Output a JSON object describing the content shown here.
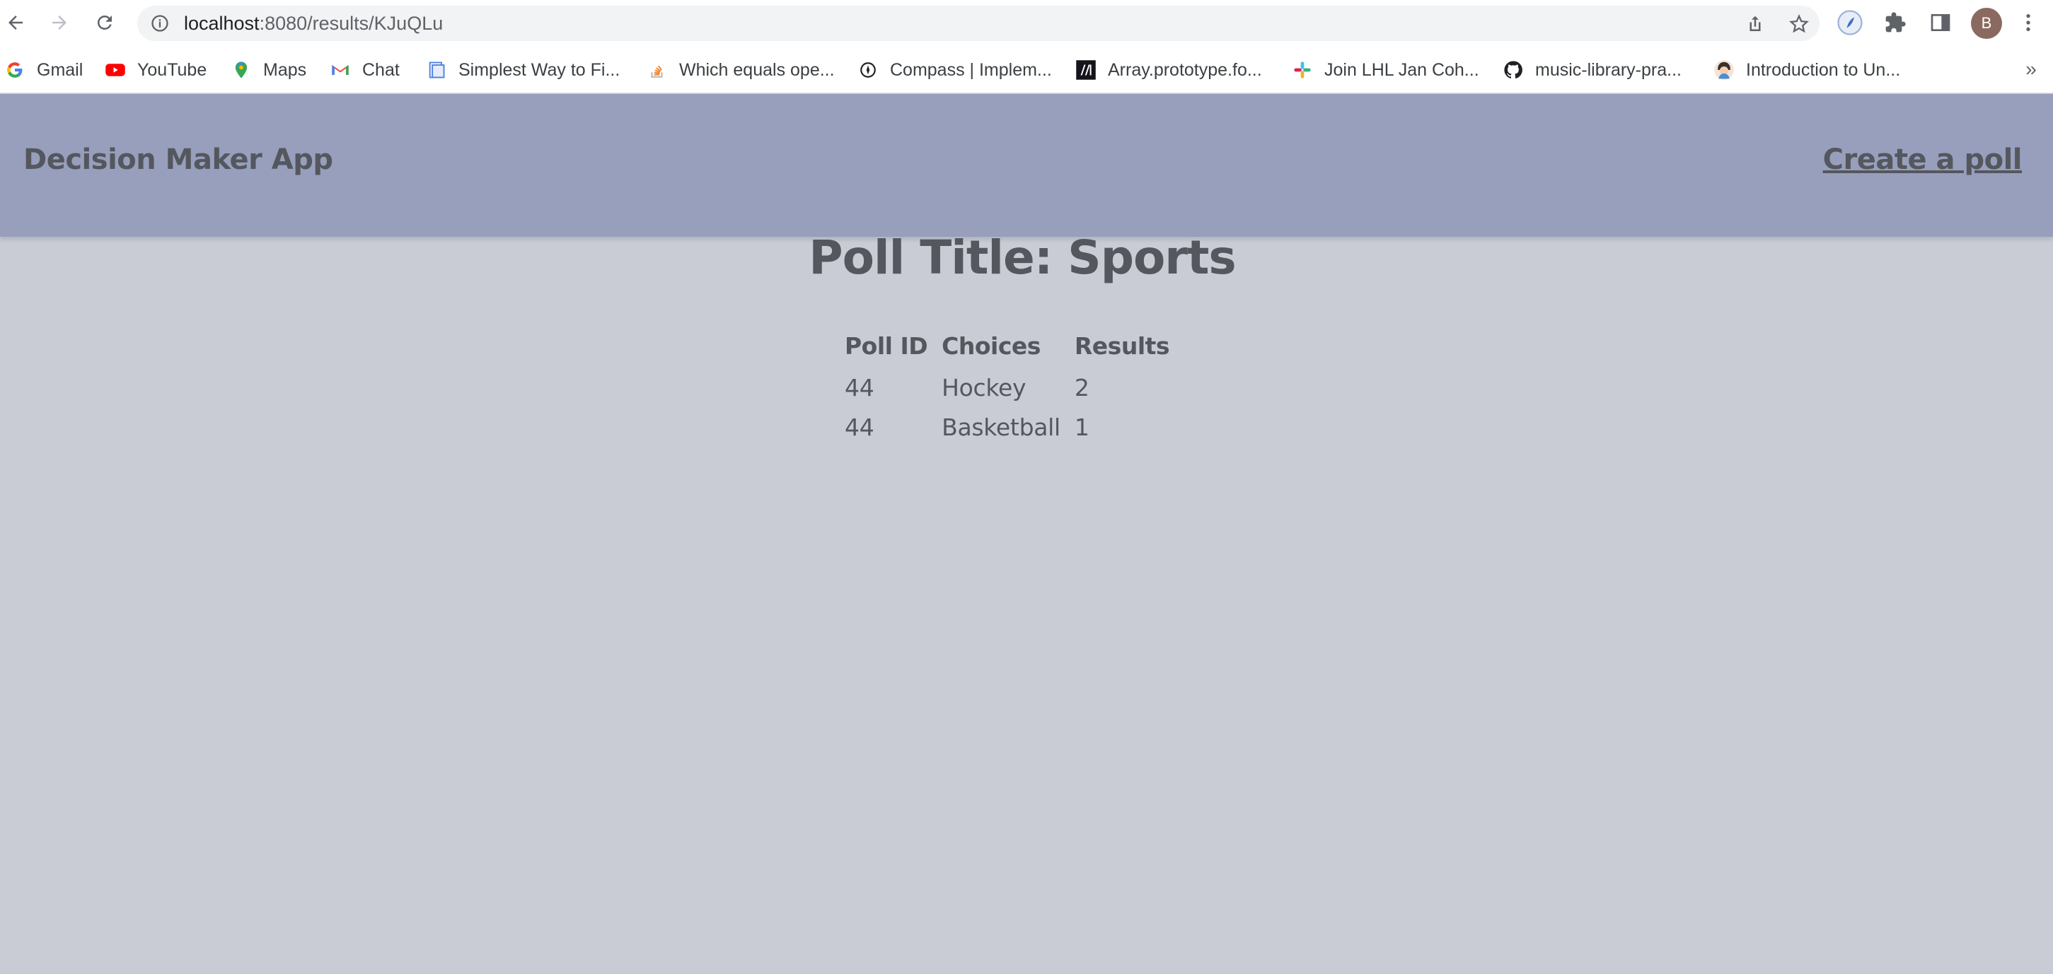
{
  "browser": {
    "url_host": "localhost",
    "url_path": ":8080/results/KJuQLu",
    "profile_initial": "B",
    "bookmarks": [
      {
        "label": "Gmail",
        "icon": "google-icon"
      },
      {
        "label": "YouTube",
        "icon": "youtube-icon"
      },
      {
        "label": "Maps",
        "icon": "maps-icon"
      },
      {
        "label": "Chat",
        "icon": "gmail-chat-icon"
      },
      {
        "label": "Simplest Way to Fi...",
        "icon": "doc-icon"
      },
      {
        "label": "Which equals ope...",
        "icon": "stackoverflow-icon"
      },
      {
        "label": "Compass | Implem...",
        "icon": "compass-icon"
      },
      {
        "label": "Array.prototype.fo...",
        "icon": "mdn-icon"
      },
      {
        "label": "Join LHL Jan Coh...",
        "icon": "slack-icon"
      },
      {
        "label": "music-library-pra...",
        "icon": "github-icon"
      },
      {
        "label": "Introduction to Un...",
        "icon": "avatar-icon"
      }
    ],
    "more_label": "»"
  },
  "header": {
    "brand": "Decision Maker App",
    "create_link": "Create a poll"
  },
  "poll": {
    "title": "Poll Title: Sports",
    "columns": [
      "Poll ID",
      "Choices",
      "Results"
    ],
    "rows": [
      {
        "poll_id": "44",
        "choice": "Hockey",
        "result": "2"
      },
      {
        "poll_id": "44",
        "choice": "Basketball",
        "result": "1"
      }
    ]
  }
}
